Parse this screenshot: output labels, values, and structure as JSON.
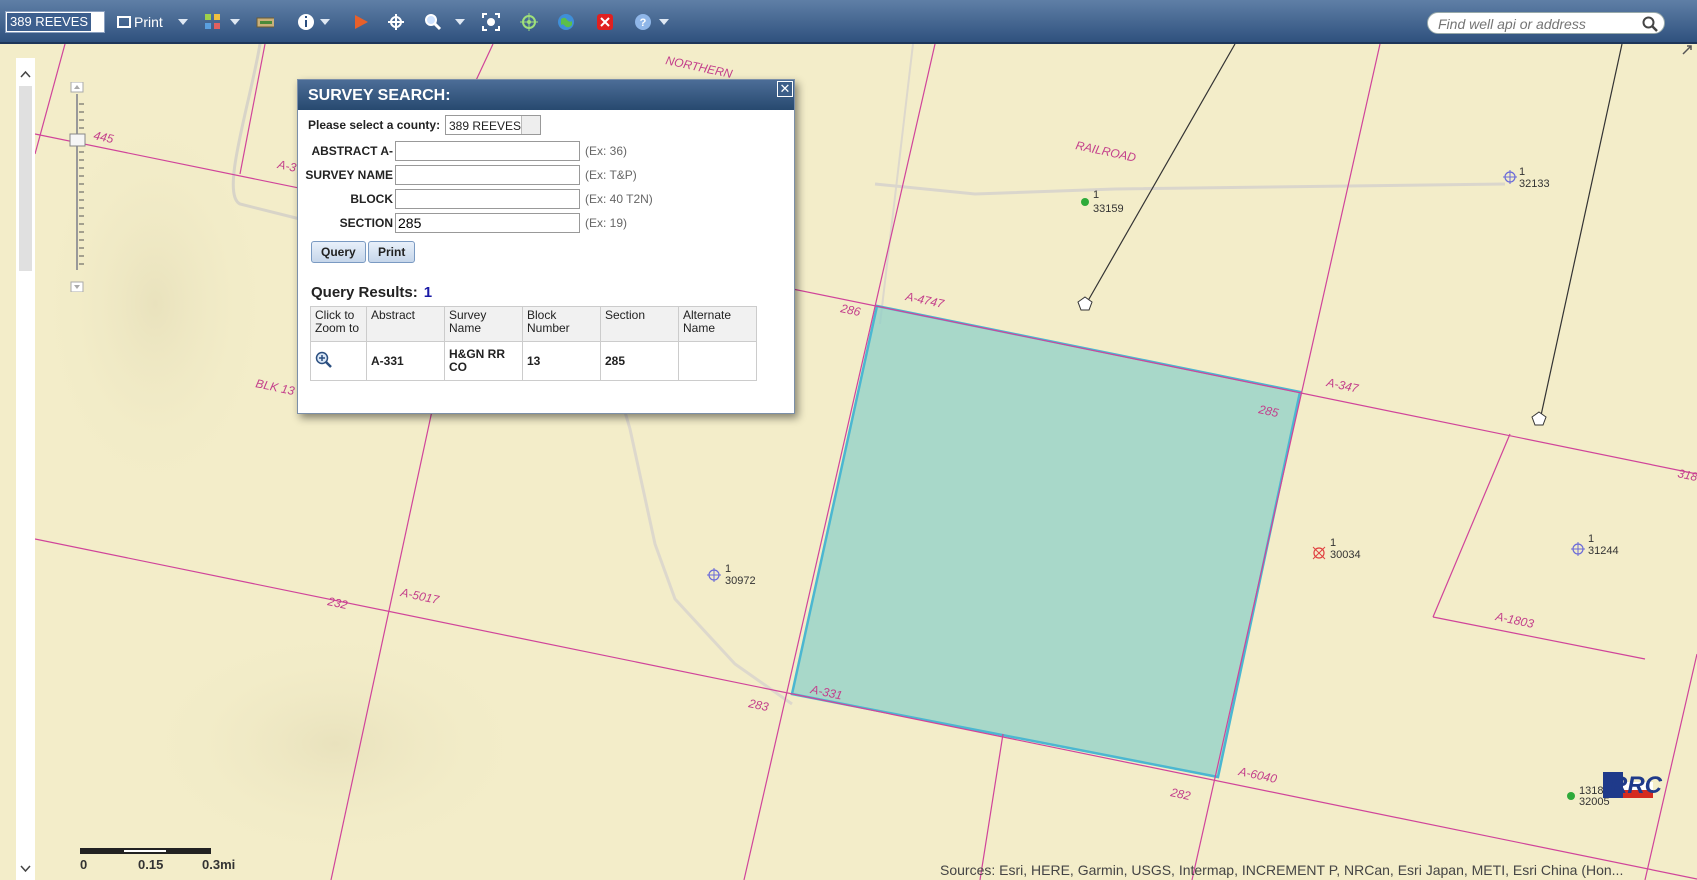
{
  "toolbar": {
    "county_value": "389 REEVES",
    "print_label": "Print",
    "search_placeholder": "Find well api or address"
  },
  "dialog": {
    "title": "SURVEY SEARCH:",
    "county_label": "Please select a county:",
    "county_value": "389 REEVES",
    "fields": {
      "abstract": {
        "label": "ABSTRACT A-",
        "value": "",
        "hint": "(Ex: 36)"
      },
      "survey_name": {
        "label": "SURVEY NAME",
        "value": "",
        "hint": "(Ex: T&P)"
      },
      "block": {
        "label": "BLOCK",
        "value": "",
        "hint": "(Ex: 40 T2N)"
      },
      "section": {
        "label": "SECTION",
        "value": "285",
        "hint": "(Ex: 19)"
      }
    },
    "query_label": "Query",
    "print_label": "Print",
    "results_label": "Query Results:",
    "results_count": "1",
    "columns": {
      "zoom": [
        "Click to",
        "Zoom to"
      ],
      "abstract": "Abstract",
      "survey": [
        "Survey",
        "Name"
      ],
      "block": [
        "Block",
        "Number"
      ],
      "section": "Section",
      "alternate": [
        "Alternate",
        "Name"
      ]
    },
    "rows": [
      {
        "abstract": "A-331",
        "survey": [
          "H&GN RR",
          "CO"
        ],
        "block": "13",
        "section": "285",
        "alternate": ""
      }
    ]
  },
  "map": {
    "labels": {
      "northern": "NORTHERN",
      "railroad": "RAILROAD",
      "blk13": "BLK 13",
      "a4747": "A-4747",
      "s286": "286",
      "s285": "285",
      "a347": "A-347",
      "a5017": "A-5017",
      "s232": "232",
      "a331": "A-331",
      "s283": "283",
      "a6040": "A-6040",
      "s282": "282",
      "a1803": "A-1803",
      "a3": "A-3",
      "s445": "445",
      "s318": "318"
    },
    "wells": [
      {
        "num": "1",
        "api": "33159"
      },
      {
        "num": "1",
        "api": "32133"
      },
      {
        "num": "1",
        "api": "30972"
      },
      {
        "num": "1",
        "api": "30034"
      },
      {
        "num": "1",
        "api": "31244"
      },
      {
        "num": "1318",
        "api": "32005"
      }
    ],
    "scale": {
      "t0": "0",
      "t1": "0.15",
      "t2": "0.3mi"
    },
    "attribution": "Sources: Esri, HERE, Garmin, USGS, Intermap, INCREMENT P, NRCan, Esri Japan, METI, Esri China (Hon..."
  },
  "colors": {
    "toolbar": "#3b5b85",
    "map_background": "#f3edc9",
    "survey_lines": "#d0449a",
    "selected_fill": "#8fd0c8"
  }
}
